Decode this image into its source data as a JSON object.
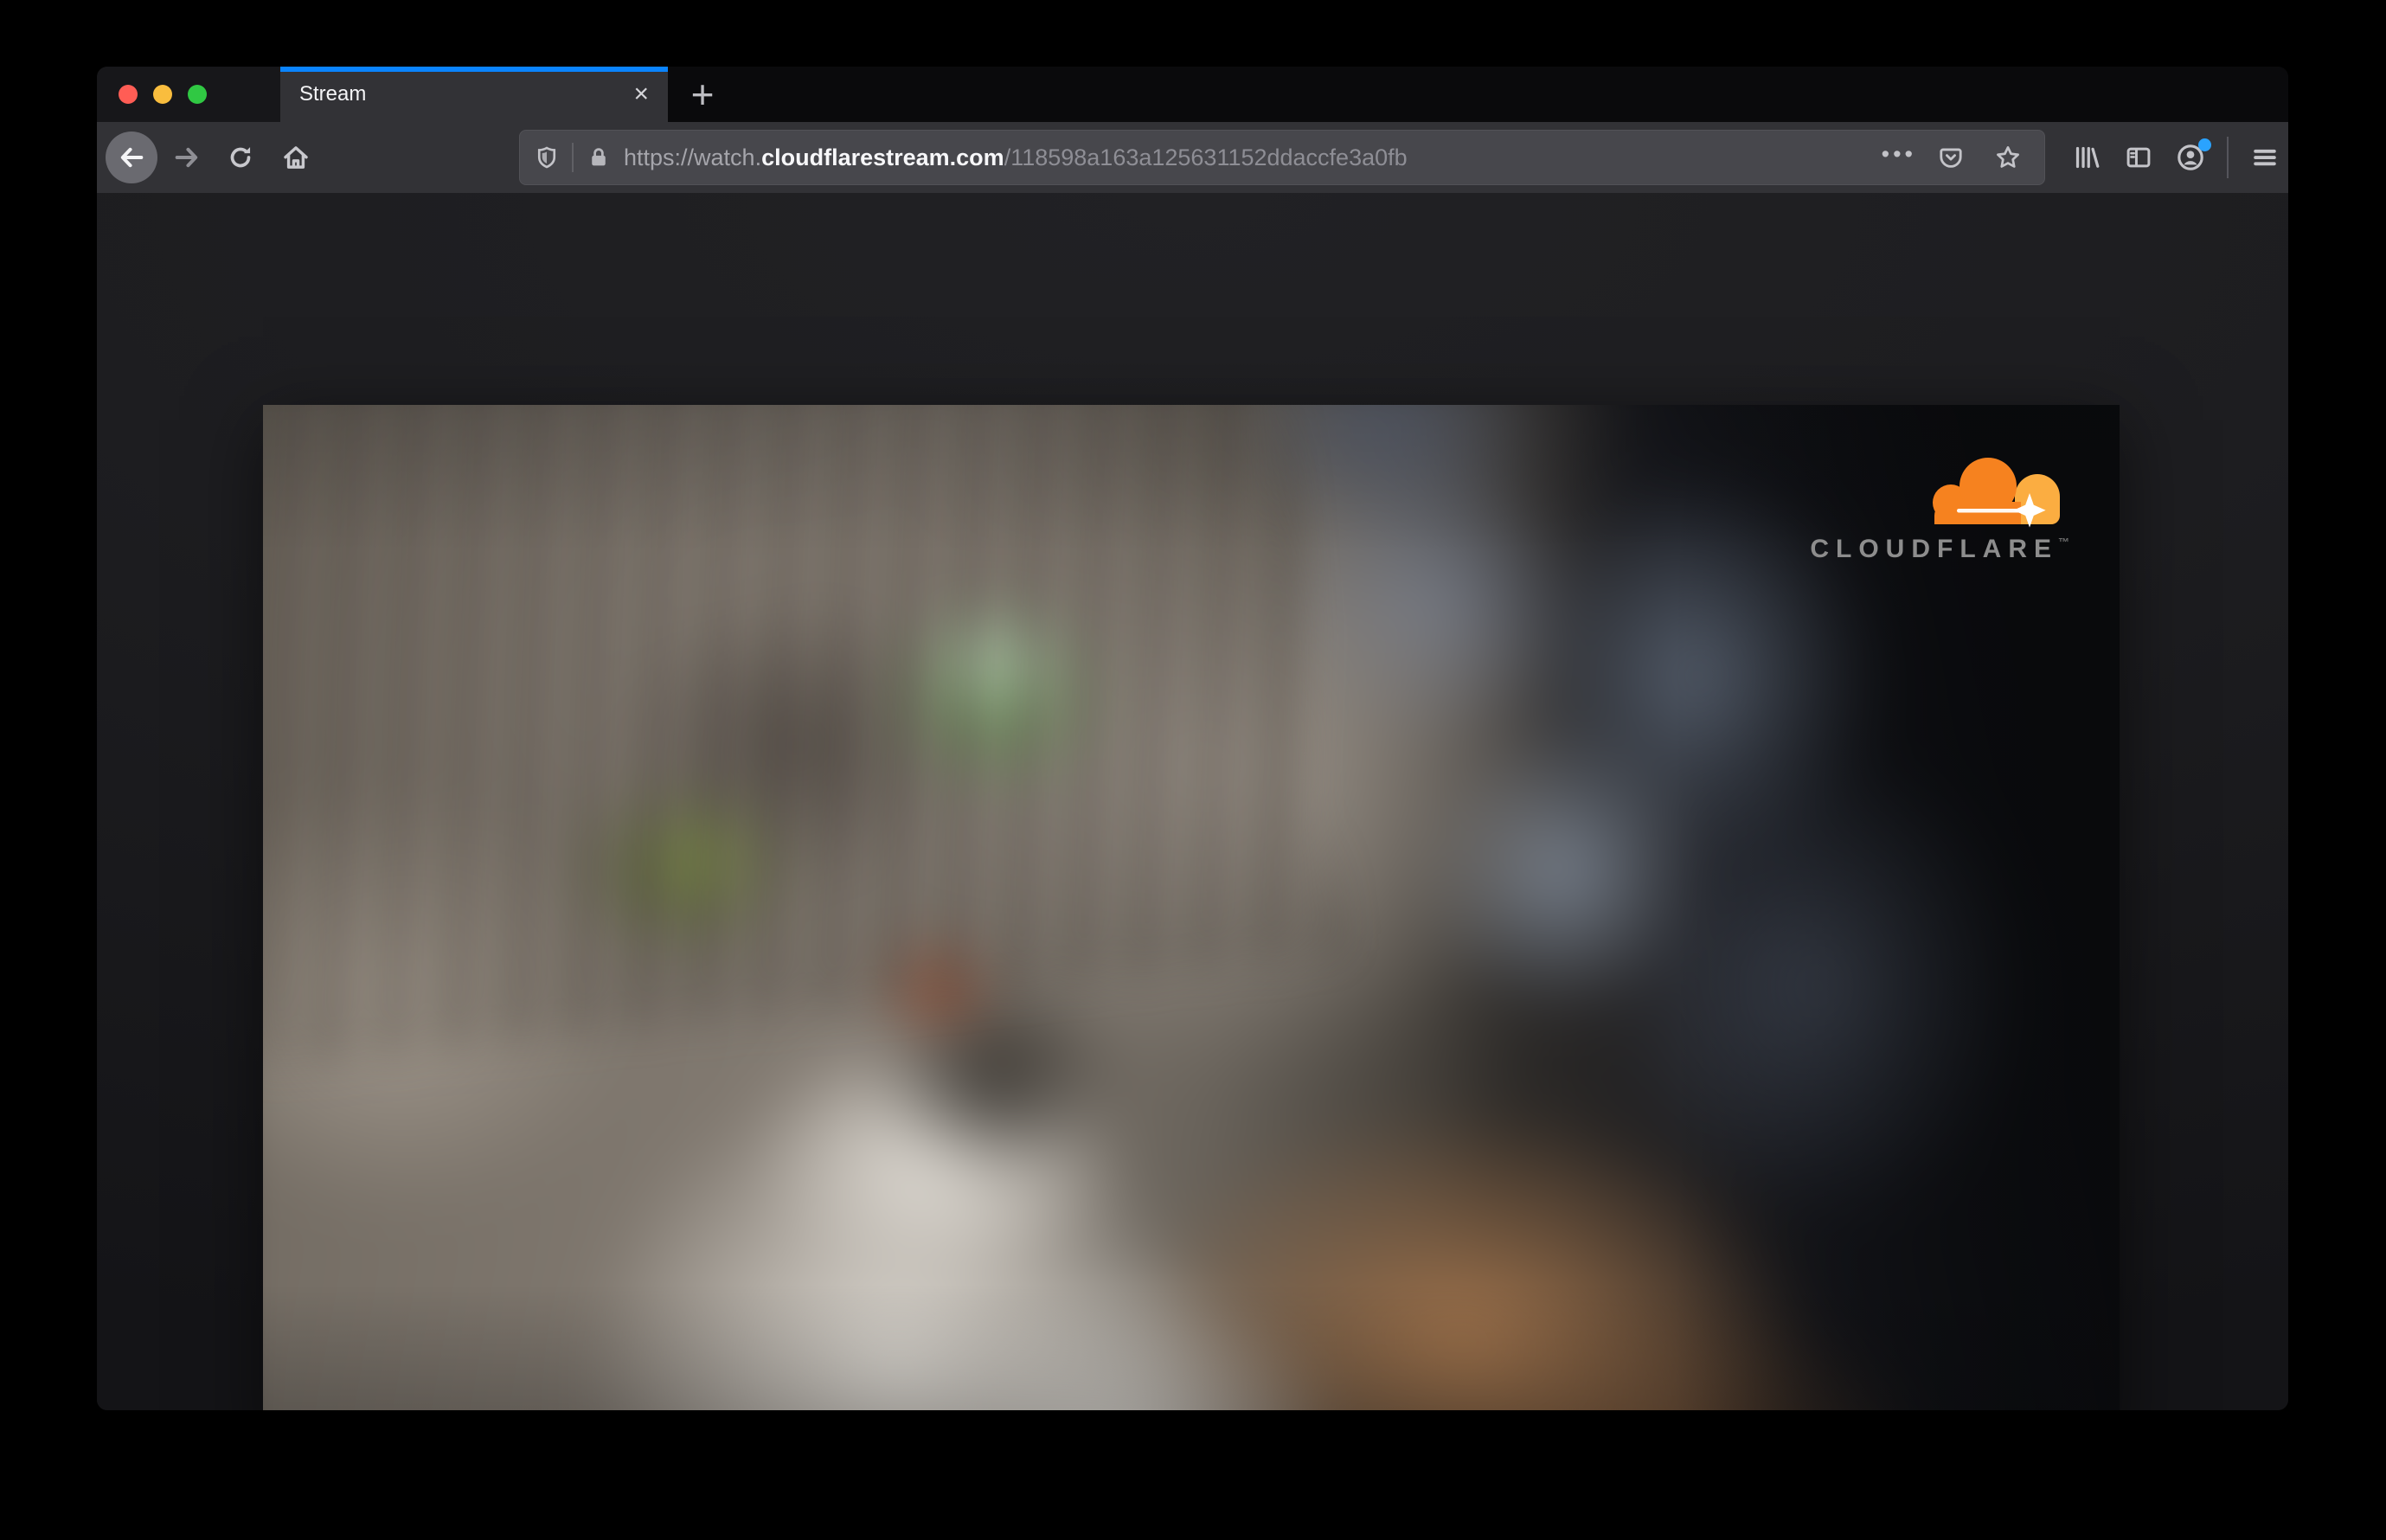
{
  "window": {
    "app": "Firefox",
    "controls": {
      "close_color": "#ff5d55",
      "minimize_color": "#f9bd3e",
      "zoom_color": "#30c843"
    }
  },
  "tab_bar": {
    "active_tab": {
      "title": "Stream",
      "close_glyph": "×"
    },
    "new_tab_glyph": "+",
    "accent_color": "#0a84ff"
  },
  "toolbar": {
    "icons": {
      "back": "arrow-left-in-circle",
      "forward": "arrow-right",
      "reload": "clockwise-circular-arrow",
      "home": "house",
      "tracking_protection": "shield-outline",
      "connection_security": "lock",
      "page_actions": "three-dots",
      "pocket": "pocket-badge-chevron",
      "bookmark": "star-outline",
      "library": "tilted-books",
      "sidebar": "split-rectangle",
      "account": "person-in-circle",
      "menu": "hamburger-bars"
    },
    "page_actions_glyph": "•••",
    "account_badge_color": "#2aa3ff",
    "url": {
      "prefix": "https://watch.",
      "domain": "cloudflarestream.com",
      "path": "/118598a163a125631152ddaccfe3a0fb",
      "full": "https://watch.cloudflarestream.com/118598a163a125631152ddaccfe3a0fb"
    }
  },
  "page": {
    "video_watermark": {
      "brand": "CLOUDFLARE",
      "trademark": "™",
      "cloud_color": "#f6821f",
      "cloud_light_color": "#fbad41",
      "brand_text_color": "#8d8d8d"
    }
  }
}
